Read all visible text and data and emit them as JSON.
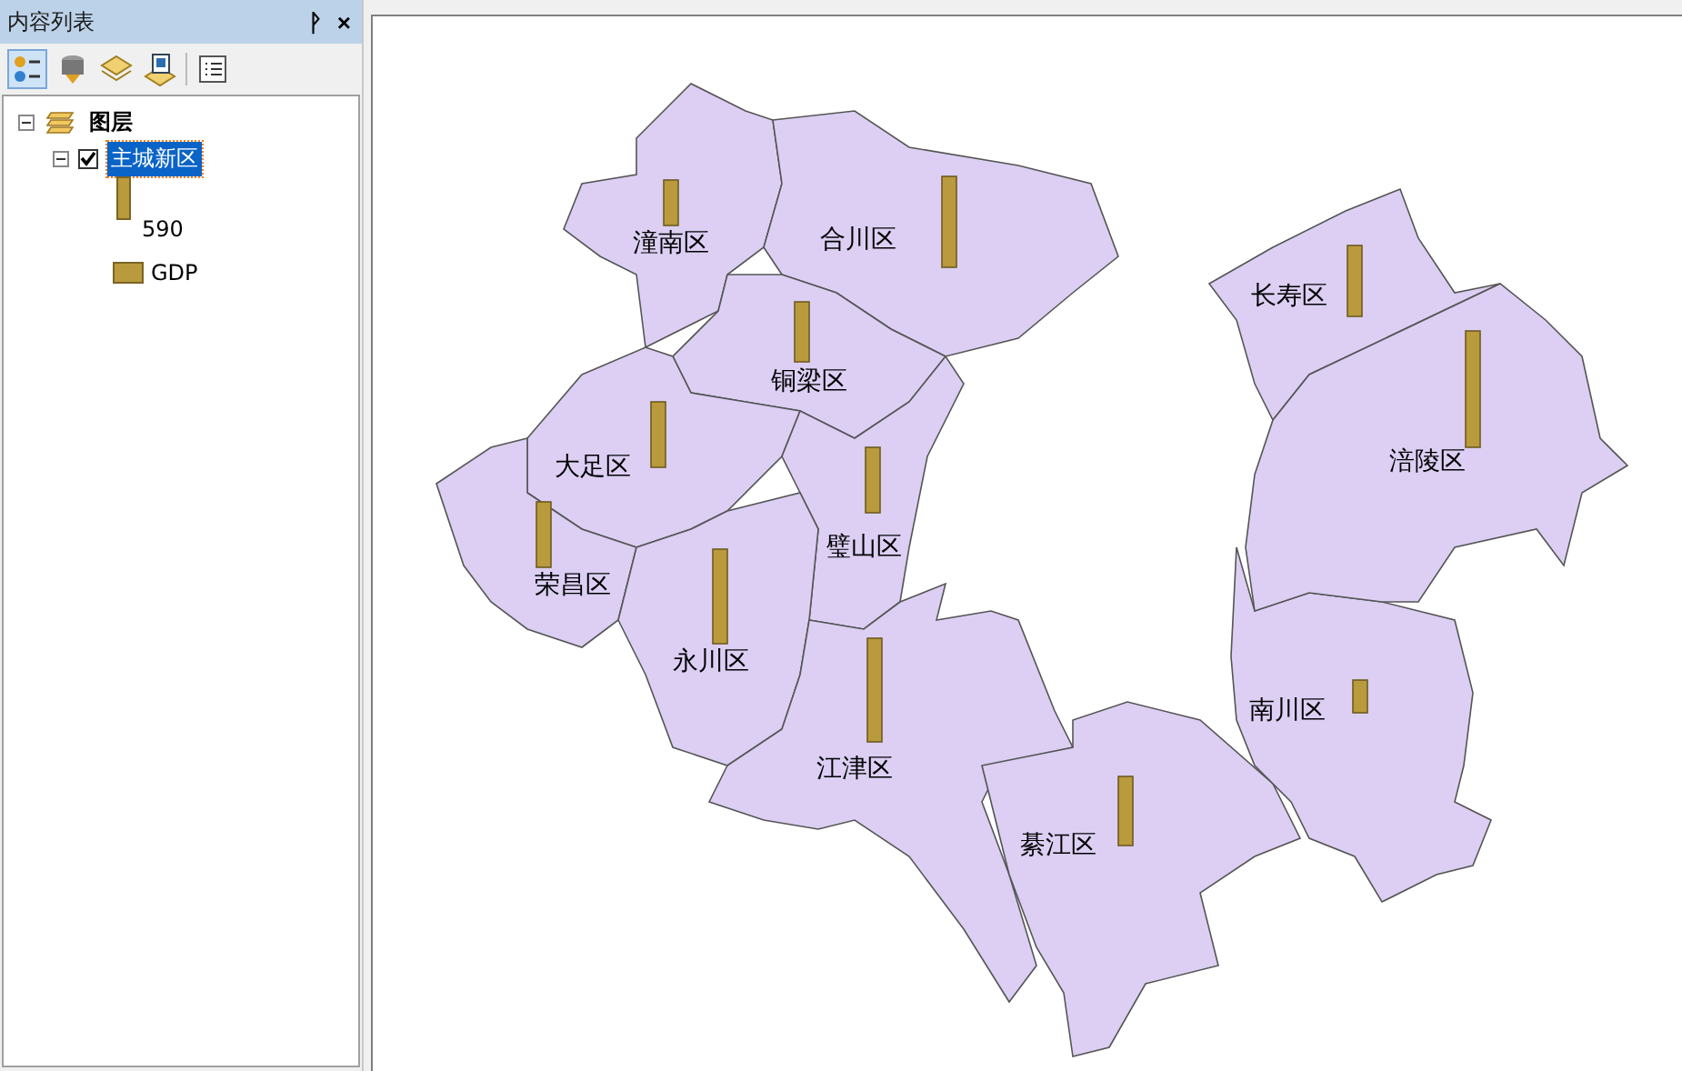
{
  "toc": {
    "title": "内容列表",
    "pin": "ᚹ",
    "close": "×",
    "tree": {
      "label": "图层",
      "expanded": true,
      "children": [
        {
          "label": "主城新区",
          "checked": true,
          "selected": true,
          "expanded": true,
          "symbol_value": "590",
          "legend": "GDP"
        }
      ]
    }
  },
  "map": {
    "districts": [
      {
        "name": "潼南区"
      },
      {
        "name": "合川区"
      },
      {
        "name": "铜梁区"
      },
      {
        "name": "大足区"
      },
      {
        "name": "荣昌区"
      },
      {
        "name": "璧山区"
      },
      {
        "name": "永川区"
      },
      {
        "name": "江津区"
      },
      {
        "name": "綦江区"
      },
      {
        "name": "南川区"
      },
      {
        "name": "长寿区"
      },
      {
        "name": "涪陵区"
      }
    ]
  }
}
